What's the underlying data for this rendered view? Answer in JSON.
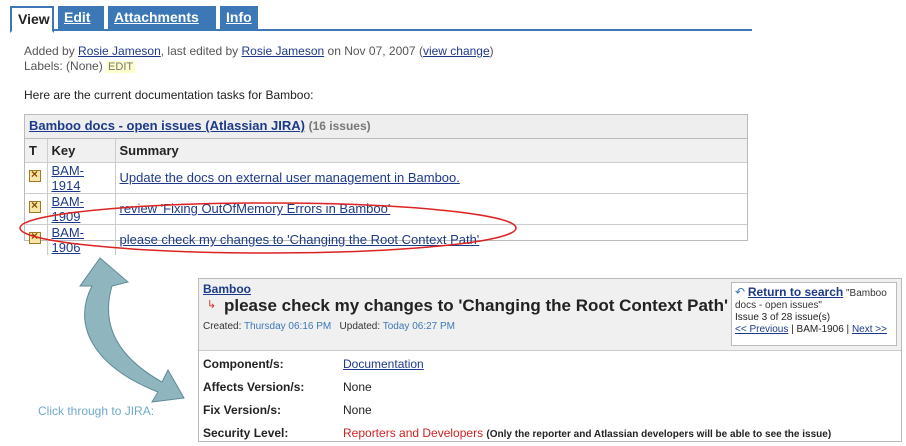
{
  "tabs": [
    {
      "label": "View",
      "active": true
    },
    {
      "label": "Edit",
      "active": false
    },
    {
      "label": "Attachments (0)",
      "active": false
    },
    {
      "label": "Info",
      "active": false
    }
  ],
  "meta": {
    "added_by_prefix": "Added by ",
    "added_by": "Rosie Jameson",
    "edited_prefix": ", last edited by ",
    "edited_by": "Rosie Jameson",
    "date_text": " on Nov 07, 2007  (",
    "view_change": "view change",
    "close_paren": ")",
    "labels_text": "Labels: (None) ",
    "edit_label": "EDIT"
  },
  "intro": "Here are the current documentation tasks for Bamboo:",
  "portlet": {
    "title": "Bamboo docs - open issues (Atlassian JIRA)",
    "count": "(16 issues)",
    "columns": [
      "T",
      "Key",
      "Summary"
    ],
    "rows": [
      {
        "key": "BAM-1914",
        "summary": "Update the docs on external user management in Bamboo."
      },
      {
        "key": "BAM-1909",
        "summary": "review 'Fixing OutOfMemory Errors in Bamboo'"
      },
      {
        "key": "BAM-1906",
        "summary": "please check my changes to 'Changing the Root Context Path'"
      }
    ]
  },
  "annotation": "Click through to JIRA:",
  "detail": {
    "project": "Bamboo",
    "title": "please check my changes to 'Changing the Root Context Path'",
    "created_label": "Created: ",
    "created_value": "Thursday 06:16 PM",
    "updated_label": "   Updated: ",
    "updated_value": "Today 06:27 PM",
    "nav": {
      "return_label": "Return to search",
      "scope": "\"Bamboo docs - open issues\"",
      "position": "Issue 3 of 28 issue(s)",
      "previous": "<< Previous",
      "current": " | BAM-1906 | ",
      "next": "Next >>"
    },
    "fields": [
      {
        "label": "Component/s:",
        "value": "Documentation"
      },
      {
        "label": "Affects Version/s:",
        "value": "None"
      },
      {
        "label": "Fix Version/s:",
        "value": "None"
      },
      {
        "label": "Security Level:",
        "value": "Reporters and Developers",
        "note": "(Only the reporter and Atlassian developers will be able to see the issue)"
      }
    ]
  },
  "colors": {
    "tab_blue": "#3c78b5",
    "link": "#1d3a8a",
    "ellipse": "#dd2222",
    "arrow": "#5f8a96"
  }
}
